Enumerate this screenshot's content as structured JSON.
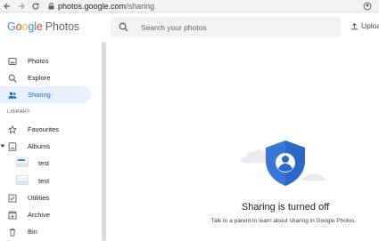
{
  "browser": {
    "url_host": "photos.google.com",
    "url_path": "/sharing"
  },
  "app": {
    "logo_google": [
      "G",
      "o",
      "o",
      "g",
      "l",
      "e"
    ],
    "logo_product": "Photos",
    "search_placeholder": "Search your photos",
    "upload_label": "Upload"
  },
  "sidebar": {
    "items": [
      {
        "label": "Photos",
        "icon": "photo-icon"
      },
      {
        "label": "Explore",
        "icon": "search-icon"
      },
      {
        "label": "Sharing",
        "icon": "people-icon",
        "active": true
      }
    ],
    "library_label": "LIBRARY",
    "library_items": [
      {
        "label": "Favourites",
        "icon": "star-icon"
      },
      {
        "label": "Albums",
        "icon": "album-icon"
      }
    ],
    "albums": [
      {
        "label": "test"
      },
      {
        "label": "test"
      }
    ],
    "more_items": [
      {
        "label": "Utilities",
        "icon": "utilities-icon"
      },
      {
        "label": "Archive",
        "icon": "archive-icon"
      },
      {
        "label": "Bin",
        "icon": "bin-icon"
      }
    ]
  },
  "main": {
    "title": "Sharing is turned off",
    "subtitle": "Talk to a parent to learn about sharing in Google Photos."
  },
  "colors": {
    "accent": "#1967d2",
    "active_bg": "#e8f0fe",
    "shield": "#3a78d8"
  }
}
